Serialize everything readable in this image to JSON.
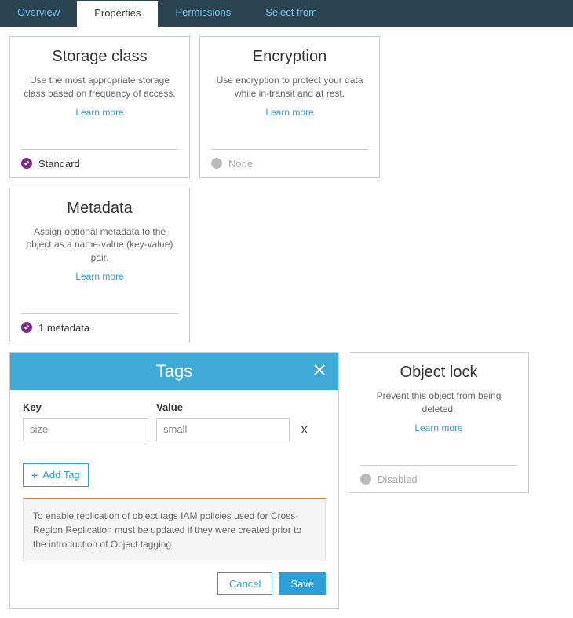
{
  "tabs": [
    {
      "label": "Overview",
      "active": false
    },
    {
      "label": "Properties",
      "active": true
    },
    {
      "label": "Permissions",
      "active": false
    },
    {
      "label": "Select from",
      "active": false
    }
  ],
  "cards": {
    "storage": {
      "title": "Storage class",
      "desc": "Use the most appropriate storage class based on frequency of access.",
      "learn": "Learn more",
      "status": "Standard"
    },
    "encryption": {
      "title": "Encryption",
      "desc": "Use encryption to protect your data while in-transit and at rest.",
      "learn": "Learn more",
      "status": "None"
    },
    "metadata": {
      "title": "Metadata",
      "desc": "Assign optional metadata to the object as a name-value (key-value) pair.",
      "learn": "Learn more",
      "status": "1 metadata"
    },
    "objectlock": {
      "title": "Object lock",
      "desc": "Prevent this object from being deleted.",
      "learn": "Learn more",
      "status": "Disabled"
    }
  },
  "tagsPanel": {
    "title": "Tags",
    "keyLabel": "Key",
    "valueLabel": "Value",
    "keyInput": "size",
    "valueInput": "small",
    "addTag": "Add Tag",
    "info": "To enable replication of object tags IAM policies used for Cross-Region Replication must be updated if they were created prior to the introduction of Object tagging.",
    "cancel": "Cancel",
    "save": "Save"
  }
}
